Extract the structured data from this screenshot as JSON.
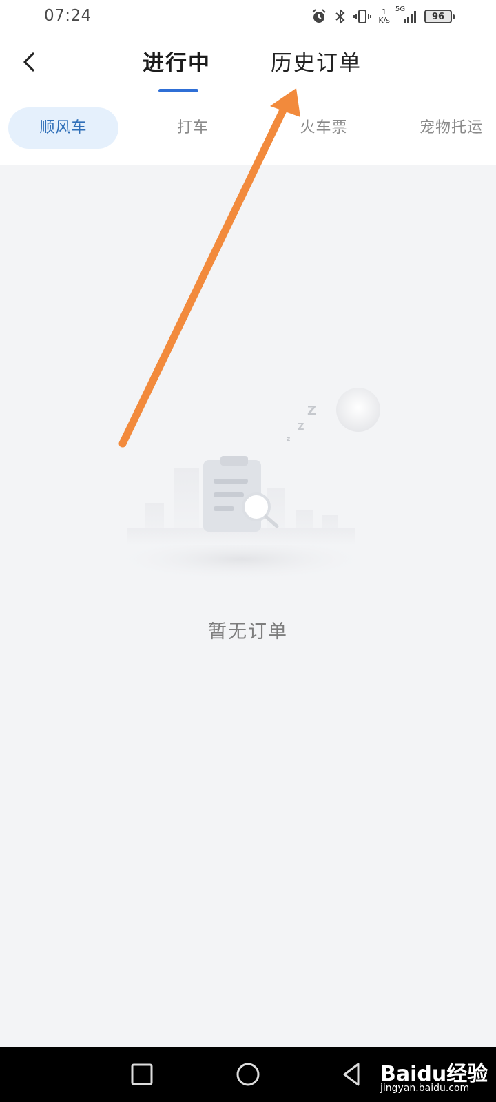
{
  "status_bar": {
    "time": "07:24",
    "net_speed_value": "1",
    "net_speed_unit": "K/s",
    "network_type": "5G",
    "battery": "96",
    "icons": [
      "alarm-icon",
      "bluetooth-icon",
      "vibrate-icon",
      "signal-icon",
      "battery-icon"
    ]
  },
  "header": {
    "back_icon": "chevron-left-icon",
    "tabs": [
      {
        "label": "进行中",
        "active": true
      },
      {
        "label": "历史订单",
        "active": false
      }
    ]
  },
  "categories": [
    {
      "label": "顺风车",
      "selected": true
    },
    {
      "label": "打车",
      "selected": false
    },
    {
      "label": "火车票",
      "selected": false
    },
    {
      "label": "宠物托运",
      "selected": false
    }
  ],
  "empty_state": {
    "message": "暂无订单",
    "illustration": "empty-order-clipboard-illustration"
  },
  "annotation": {
    "type": "arrow",
    "color": "#f28a3c",
    "points_to": "历史订单"
  },
  "nav_bar": {
    "buttons": [
      "recent-apps-icon",
      "home-icon",
      "back-triangle-icon"
    ]
  },
  "watermark": {
    "logo": "Baidu经验",
    "url": "jingyan.baidu.com"
  },
  "colors": {
    "accent": "#2f6fd6",
    "chip_bg": "#e5f0fc",
    "chip_text": "#2f6fb8",
    "page_bg": "#f3f4f6",
    "arrow": "#f28a3c"
  }
}
